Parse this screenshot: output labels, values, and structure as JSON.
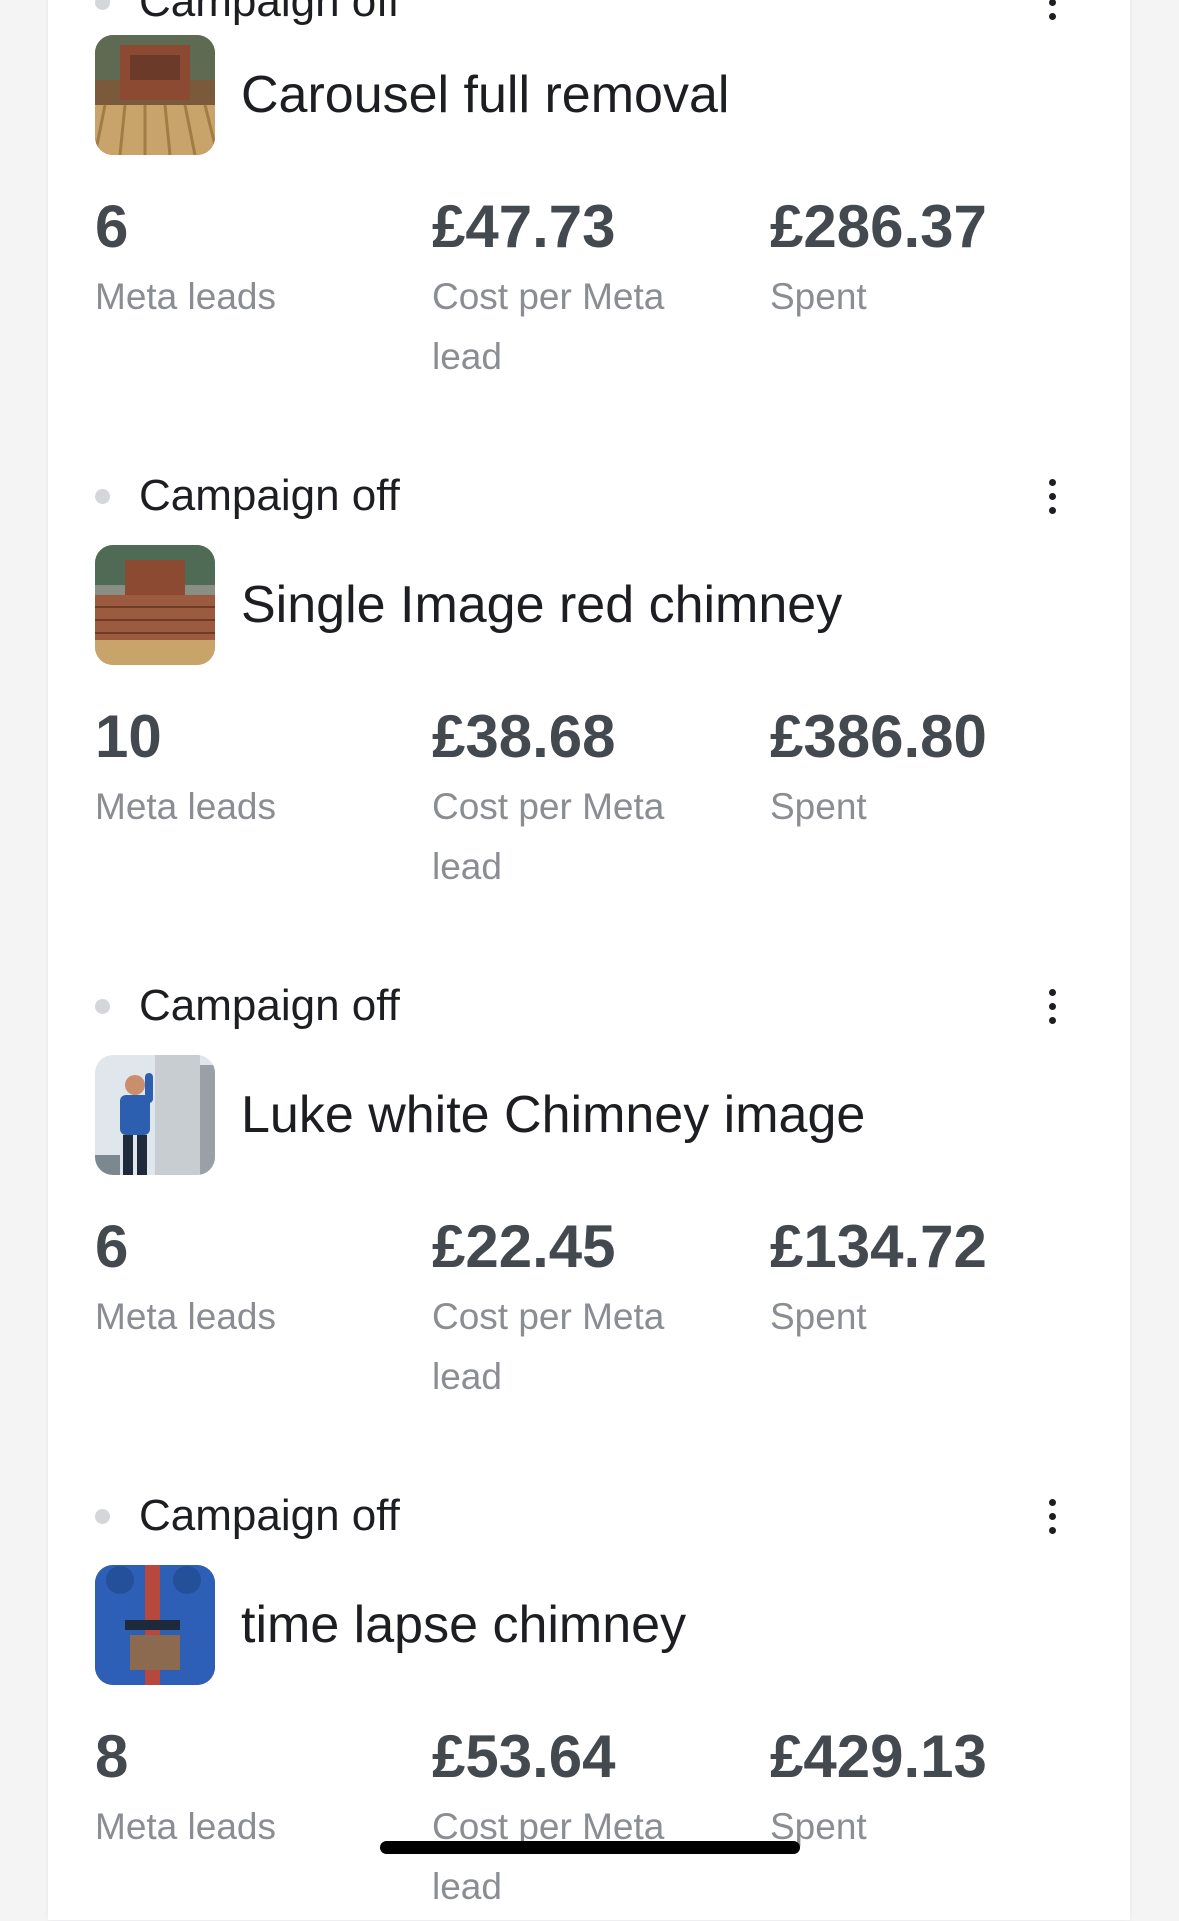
{
  "campaigns": [
    {
      "status": "Campaign off",
      "ad_name": "Carousel full removal",
      "thumbnail": "chimney-removal-thumbnail",
      "metrics": [
        {
          "value": "6",
          "label": "Meta leads"
        },
        {
          "value": "£47.73",
          "label": "Cost per Meta lead"
        },
        {
          "value": "£286.37",
          "label": "Spent"
        }
      ]
    },
    {
      "status": "Campaign off",
      "ad_name": "Single Image red chimney",
      "thumbnail": "red-chimney-thumbnail",
      "metrics": [
        {
          "value": "10",
          "label": "Meta leads"
        },
        {
          "value": "£38.68",
          "label": "Cost per Meta lead"
        },
        {
          "value": "£386.80",
          "label": "Spent"
        }
      ]
    },
    {
      "status": "Campaign off",
      "ad_name": "Luke white Chimney image",
      "thumbnail": "white-chimney-thumbnail",
      "metrics": [
        {
          "value": "6",
          "label": "Meta leads"
        },
        {
          "value": "£22.45",
          "label": "Cost per Meta lead"
        },
        {
          "value": "£134.72",
          "label": "Spent"
        }
      ]
    },
    {
      "status": "Campaign off",
      "ad_name": "time lapse chimney",
      "thumbnail": "time-lapse-thumbnail",
      "metrics": [
        {
          "value": "8",
          "label": "Meta leads"
        },
        {
          "value": "£53.64",
          "label": "Cost per Meta lead"
        },
        {
          "value": "£429.13",
          "label": "Spent"
        }
      ]
    }
  ],
  "icons": {
    "more": "more-options-icon",
    "status": "status-dot-icon"
  },
  "colors": {
    "status_dot": "#d4d6da",
    "metric_value": "#444950",
    "metric_label": "#8a8d91"
  }
}
